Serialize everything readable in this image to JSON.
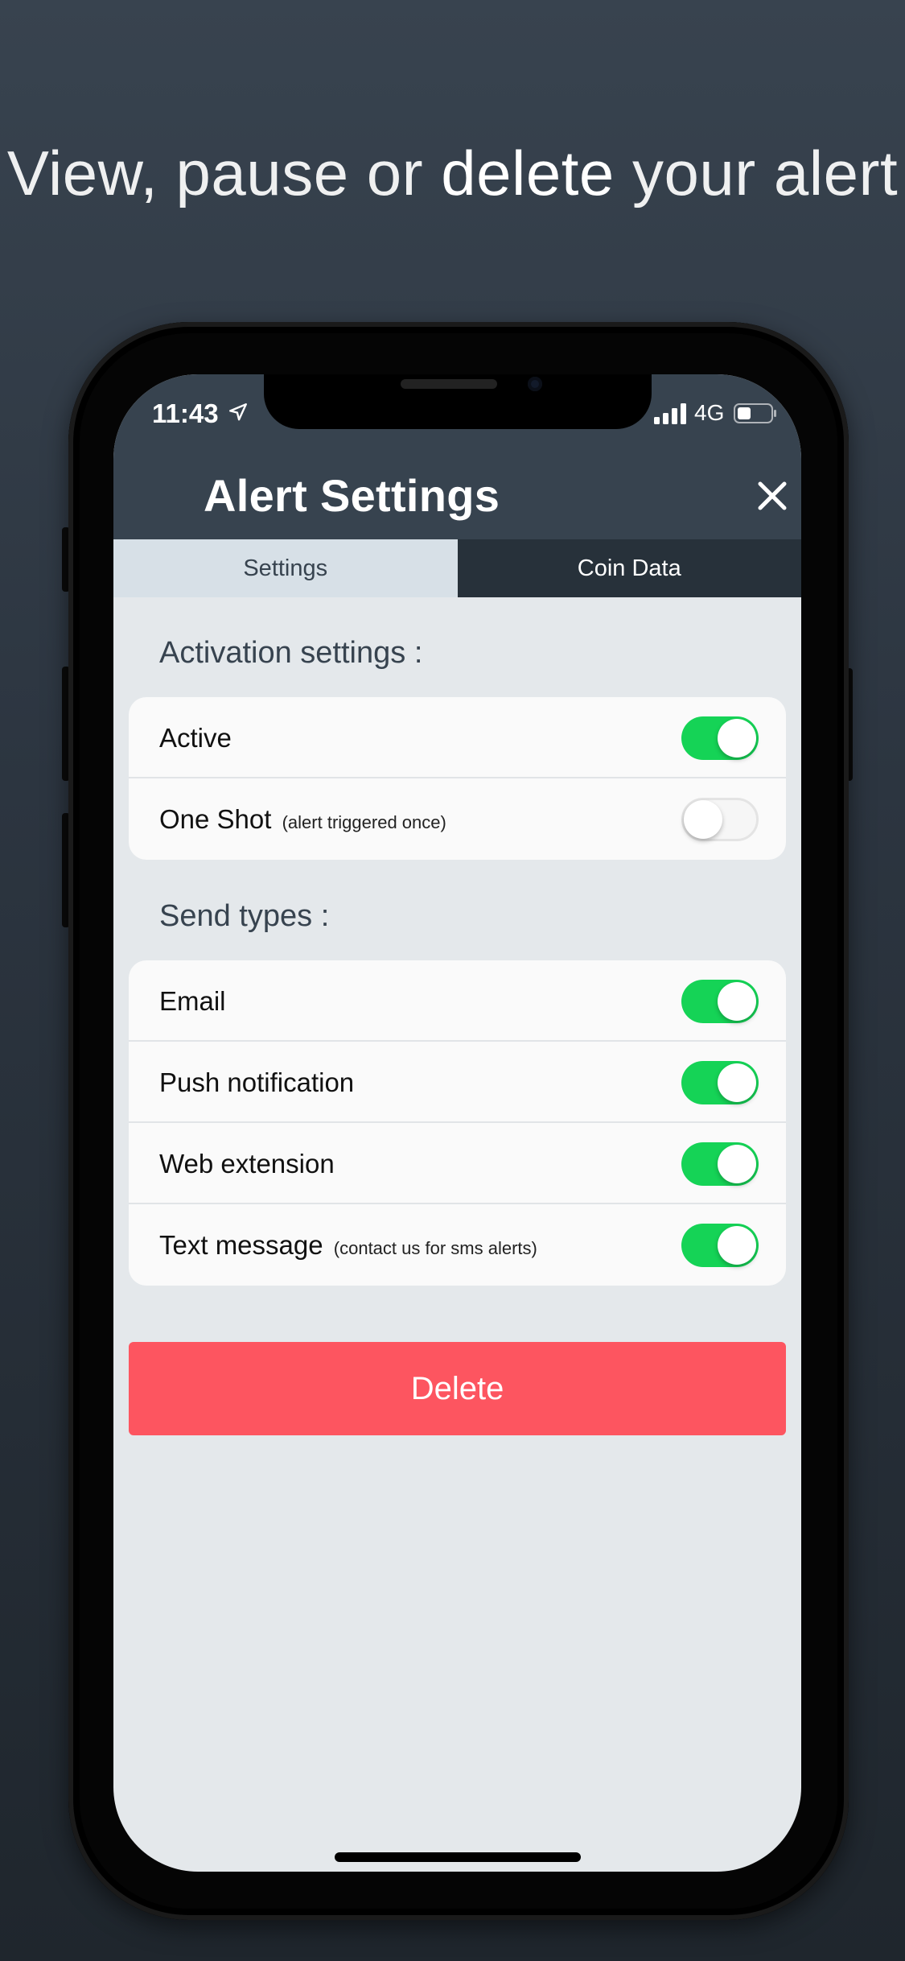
{
  "headline": {
    "part1": "View, pause",
    "part2": "or",
    "part3": "delete",
    "part4": "your alert"
  },
  "status_bar": {
    "time": "11:43",
    "network": "4G",
    "icons": [
      "location-arrow-icon",
      "signal-bars-icon",
      "battery-icon"
    ]
  },
  "header": {
    "title": "Alert Settings",
    "close_icon": "close-icon"
  },
  "tabs": [
    {
      "label": "Settings",
      "active": true
    },
    {
      "label": "Coin Data",
      "active": false
    }
  ],
  "activation": {
    "title": "Activation settings :",
    "rows": [
      {
        "label": "Active",
        "note": "",
        "on": true
      },
      {
        "label": "One Shot",
        "note": "(alert triggered once)",
        "on": false
      }
    ]
  },
  "send_types": {
    "title": "Send types :",
    "rows": [
      {
        "label": "Email",
        "note": "",
        "on": true
      },
      {
        "label": "Push notification",
        "note": "",
        "on": true
      },
      {
        "label": "Web extension",
        "note": "",
        "on": true
      },
      {
        "label": "Text message",
        "note": "(contact us for sms alerts)",
        "on": true
      }
    ]
  },
  "delete_label": "Delete",
  "colors": {
    "header_bg": "#37434f",
    "toggle_on": "#15d356",
    "delete_bg": "#fd5560",
    "content_bg": "#e4e8eb"
  }
}
